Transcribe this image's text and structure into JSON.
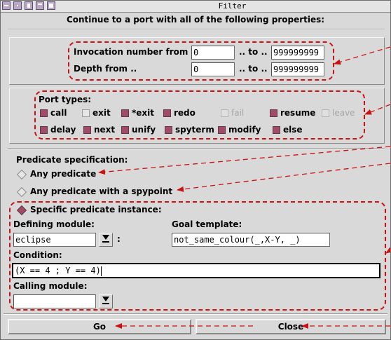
{
  "window": {
    "title": "Filter"
  },
  "header": "Continue to a port with all of the following properties:",
  "ranges": {
    "invocation_label": "Invocation number from ..",
    "invocation_from": "0",
    "invocation_to": "999999999",
    "depth_label": "Depth from ..",
    "depth_from": "0",
    "depth_to": "999999999",
    "to_label": ".. to .."
  },
  "ports": {
    "label": "Port types:",
    "items": [
      {
        "label": "call",
        "checked": true,
        "enabled": true
      },
      {
        "label": "exit",
        "checked": false,
        "enabled": true
      },
      {
        "label": "*exit",
        "checked": true,
        "enabled": true
      },
      {
        "label": "redo",
        "checked": true,
        "enabled": true
      },
      {
        "label": "fail",
        "checked": false,
        "enabled": false
      },
      {
        "label": "resume",
        "checked": true,
        "enabled": true
      },
      {
        "label": "leave",
        "checked": false,
        "enabled": false
      },
      {
        "label": "delay",
        "checked": true,
        "enabled": true
      },
      {
        "label": "next",
        "checked": true,
        "enabled": true
      },
      {
        "label": "unify",
        "checked": true,
        "enabled": true
      },
      {
        "label": "spyterm",
        "checked": true,
        "enabled": true
      },
      {
        "label": "modify",
        "checked": true,
        "enabled": true
      },
      {
        "label": "else",
        "checked": true,
        "enabled": true
      }
    ]
  },
  "predicate": {
    "label": "Predicate specification:",
    "options": [
      {
        "label": "Any predicate",
        "selected": false
      },
      {
        "label": "Any predicate with a spypoint",
        "selected": false
      },
      {
        "label": "Specific predicate instance:",
        "selected": true
      }
    ],
    "defining_module_label": "Defining module:",
    "defining_module_value": "eclipse",
    "colon": ":",
    "goal_template_label": "Goal template:",
    "goal_template_value": "not_same_colour(_,X-Y, _)",
    "condition_label": "Condition:",
    "condition_value": "(X == 4 ; Y == 4)",
    "calling_module_label": "Calling module:",
    "calling_module_value": ""
  },
  "buttons": {
    "go": "Go",
    "close": "Close"
  },
  "colors": {
    "annotation": "#cc1111",
    "checked": "#a24a66",
    "window_bg": "#d9d9d9"
  },
  "icons": {
    "dropdown": "down-arrow-with-bar-icon"
  }
}
